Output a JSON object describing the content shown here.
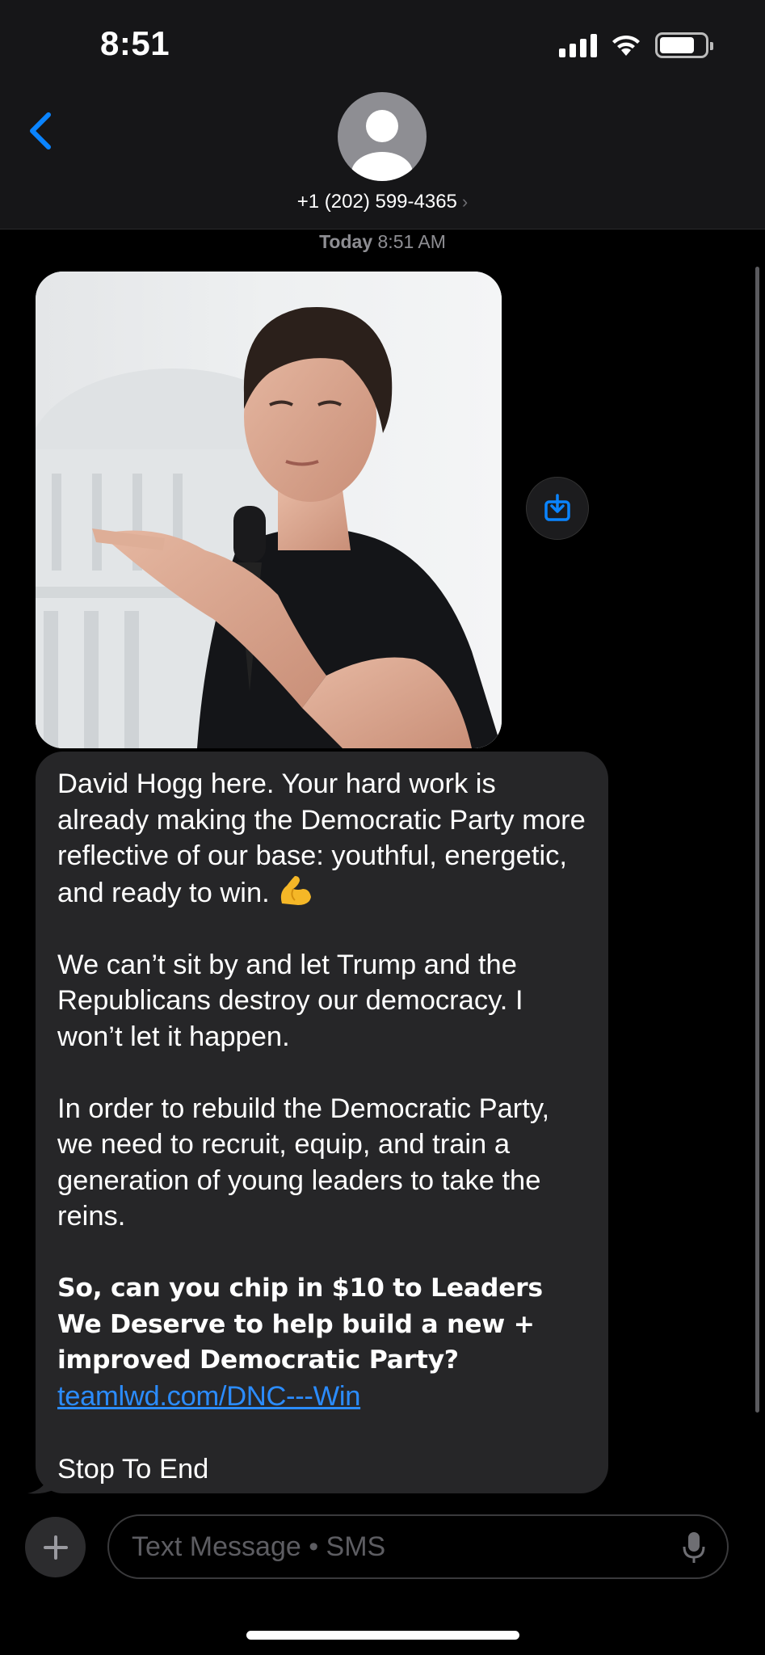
{
  "status_bar": {
    "time": "8:51",
    "icons": [
      "cellular-signal-icon",
      "wifi-icon",
      "battery-icon"
    ]
  },
  "header": {
    "back_icon": "chevron-left-icon",
    "avatar_icon": "person-icon",
    "contact": "+1 (202) 599-4365",
    "chevron": "›"
  },
  "thread": {
    "timestamp_day": "Today",
    "timestamp_time": "8:51 AM"
  },
  "message": {
    "image_alt": "Photo of a young man with a microphone",
    "save_icon": "save-to-device-icon",
    "para1": "David Hogg here. Your hard work is already making the Democratic Party more reflective of our base: youthful, energetic, and ready to win.",
    "emoji_icon": "flexed-biceps-icon",
    "para2": "We can’t sit by and let Trump and the Republicans destroy our democracy. I won’t let it happen.",
    "para3": "In order to rebuild the Democratic Party, we need to recruit, equip, and train a generation of young leaders to take the reins.",
    "para4_bold": "So, can you chip in $10 to Leaders We Deserve to help build a new + improved Democratic Party?",
    "link": "teamlwd.com/DNC---Win",
    "footer": "Stop To End"
  },
  "composer": {
    "plus_icon": "plus-icon",
    "placeholder": "Text Message • SMS",
    "mic_icon": "microphone-icon"
  },
  "colors": {
    "accent": "#0a84ff",
    "bubble": "#262628",
    "link": "#2b8cff"
  }
}
